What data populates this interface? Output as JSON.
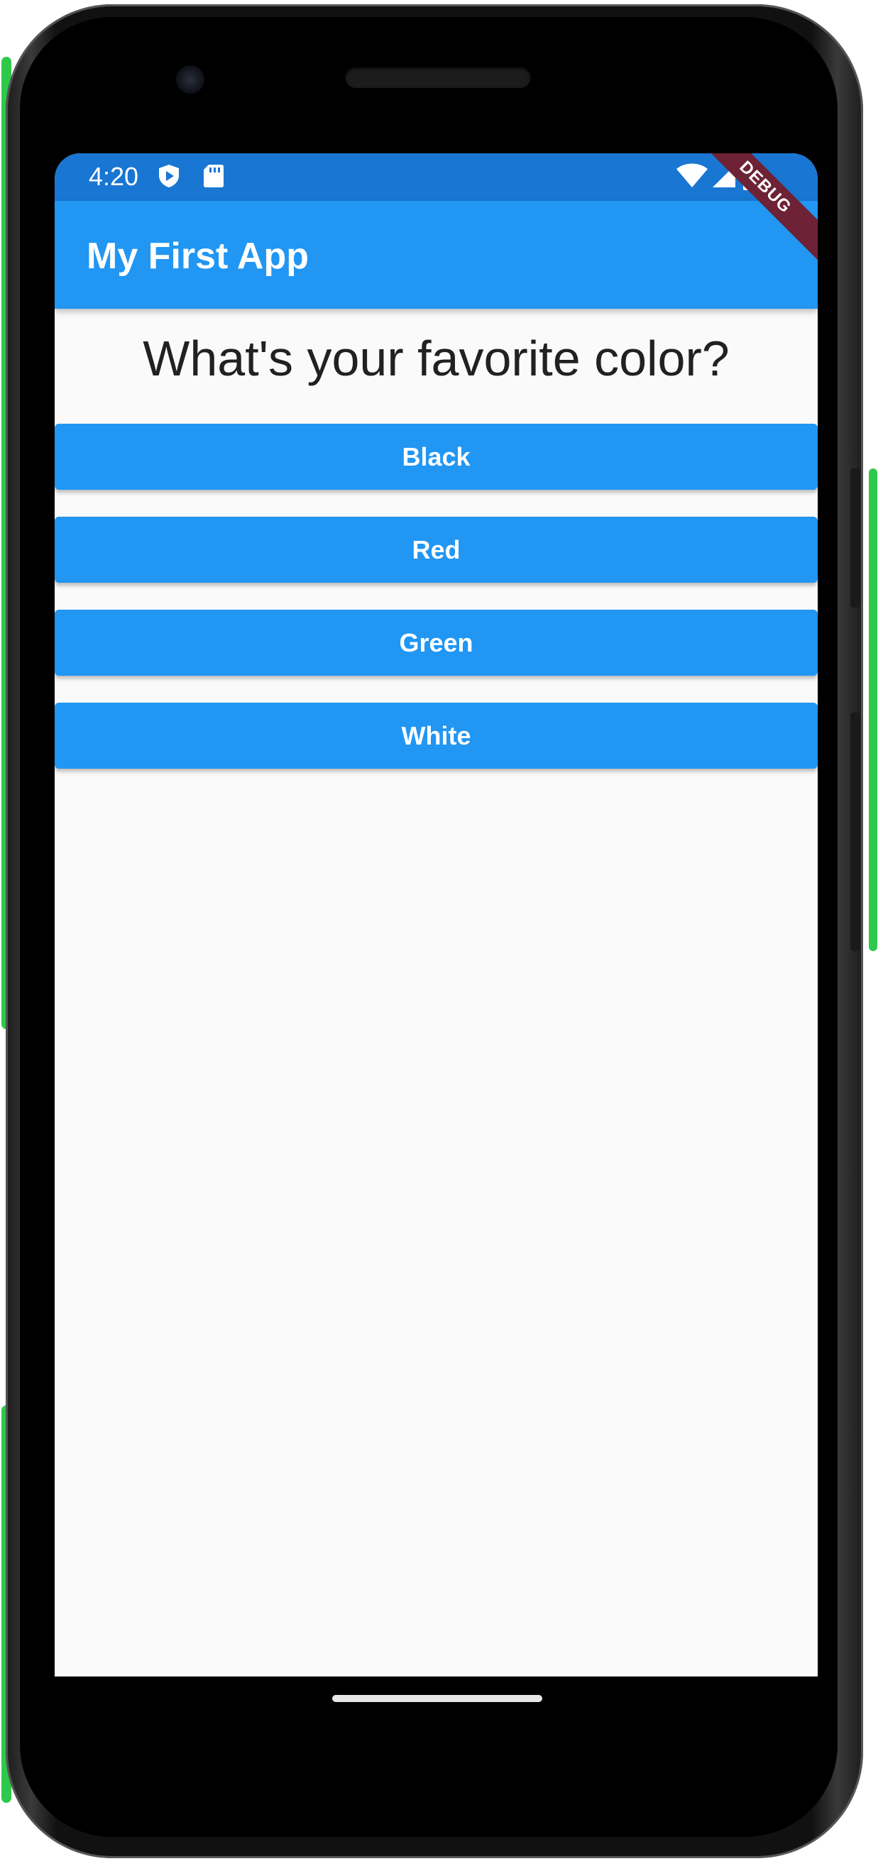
{
  "status_bar": {
    "time": "4:20",
    "left_icons": [
      "shield-play-icon",
      "sd-card-icon"
    ],
    "right_icons": [
      "wifi-icon",
      "cell-signal-icon",
      "battery-icon"
    ],
    "color": "#1976d2"
  },
  "debug_banner": {
    "label": "DEBUG",
    "color": "#6d2236"
  },
  "app_bar": {
    "title": "My First App",
    "color": "#2196f3"
  },
  "main": {
    "question": "What's your favorite color?",
    "answers": [
      {
        "label": "Black"
      },
      {
        "label": "Red"
      },
      {
        "label": "Green"
      },
      {
        "label": "White"
      }
    ],
    "button_color": "#2196f3",
    "background_color": "#fafafa"
  }
}
